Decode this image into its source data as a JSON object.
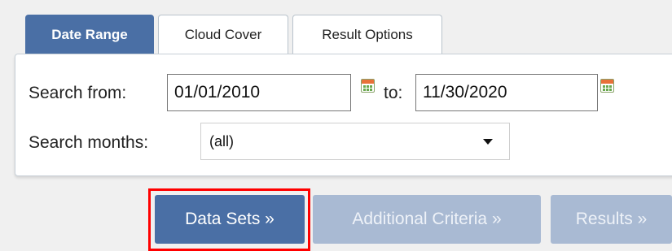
{
  "tabs": [
    {
      "label": "Date Range",
      "active": true
    },
    {
      "label": "Cloud Cover",
      "active": false
    },
    {
      "label": "Result Options",
      "active": false
    }
  ],
  "date_range": {
    "search_from_label": "Search from:",
    "from_value": "01/01/2010",
    "to_label": "to:",
    "to_value": "11/30/2020",
    "search_months_label": "Search months:",
    "months_selected": "(all)"
  },
  "buttons": {
    "data_sets": "Data Sets »",
    "additional_criteria": "Additional Criteria »",
    "results": "Results »"
  },
  "colors": {
    "accent": "#4a6fa5",
    "disabled_button": "#a9bad3",
    "highlight": "#ff0000"
  },
  "icons": [
    "calendar-icon",
    "chevron-down-icon"
  ]
}
